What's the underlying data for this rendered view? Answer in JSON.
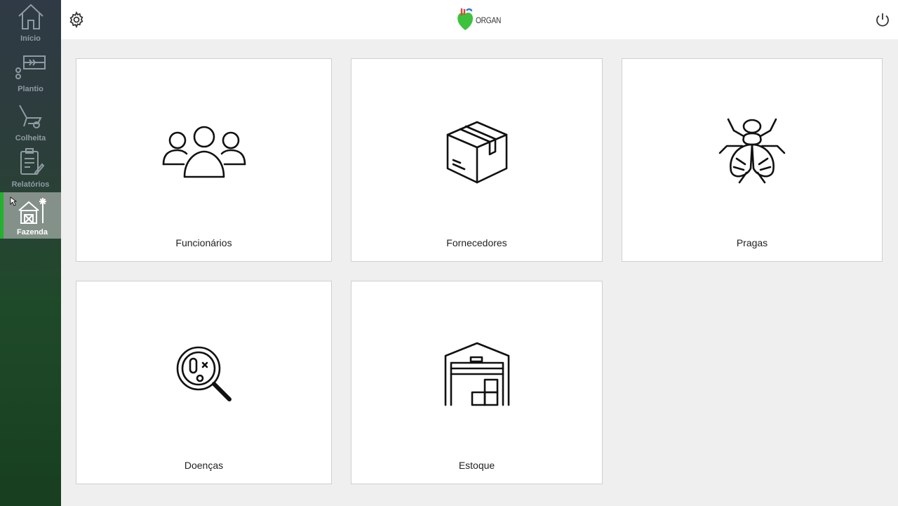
{
  "app": {
    "brand": "ORGAN",
    "accent_color": "#22b02e",
    "settings_icon": "gear-icon",
    "power_icon": "power-icon"
  },
  "sidebar": {
    "items": [
      {
        "label": "Início",
        "icon": "home-icon",
        "active": false
      },
      {
        "label": "Plantio",
        "icon": "planting-icon",
        "active": false
      },
      {
        "label": "Colheita",
        "icon": "wheelbarrow-icon",
        "active": false
      },
      {
        "label": "Relatórios",
        "icon": "clipboard-icon",
        "active": false
      },
      {
        "label": "Fazenda",
        "icon": "farm-icon",
        "active": true
      }
    ]
  },
  "cards": [
    {
      "label": "Funcionários",
      "icon": "people-icon"
    },
    {
      "label": "Fornecedores",
      "icon": "box-icon"
    },
    {
      "label": "Pragas",
      "icon": "fly-icon"
    },
    {
      "label": "Doenças",
      "icon": "magnifier-bacteria-icon"
    },
    {
      "label": "Estoque",
      "icon": "warehouse-icon"
    }
  ]
}
